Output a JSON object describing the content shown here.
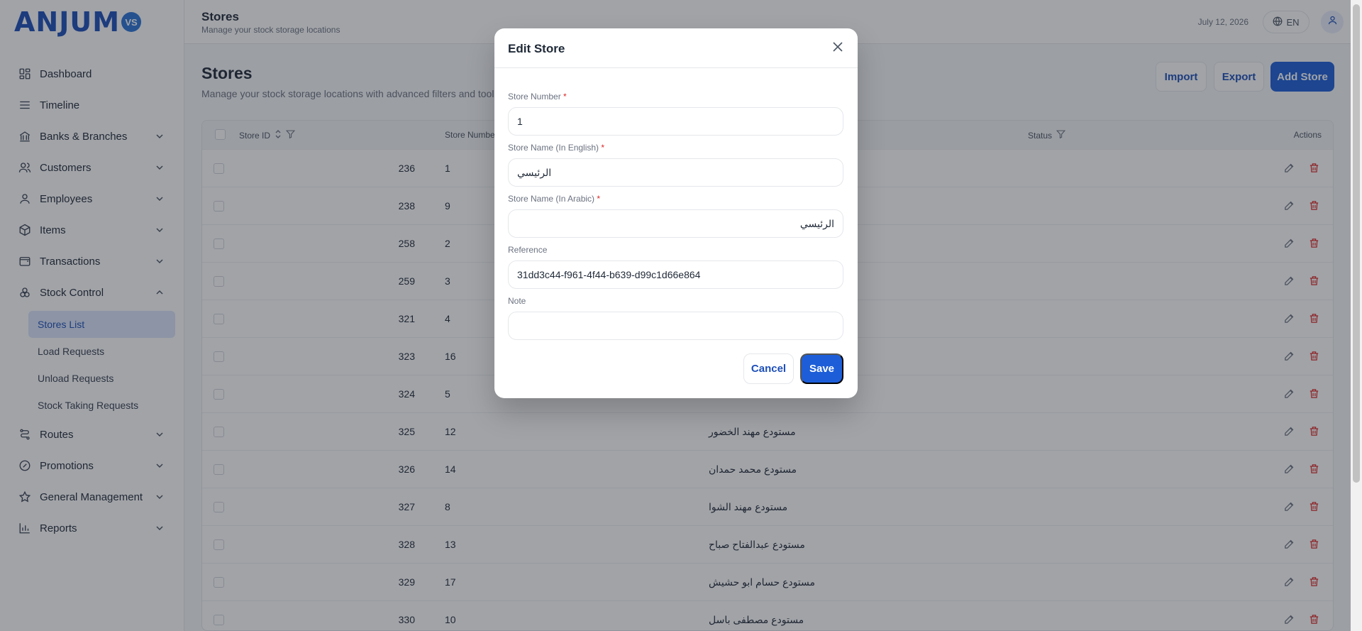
{
  "brand": {
    "logo_text": "ANJUM",
    "logo_badge": "VS"
  },
  "sidebar": {
    "items": [
      {
        "label": "Dashboard",
        "icon": "dashboard-icon",
        "expandable": false
      },
      {
        "label": "Timeline",
        "icon": "list-icon",
        "expandable": false
      },
      {
        "label": "Banks & Branches",
        "icon": "bank-icon",
        "expandable": true
      },
      {
        "label": "Customers",
        "icon": "users-icon",
        "expandable": true
      },
      {
        "label": "Employees",
        "icon": "user-icon",
        "expandable": true
      },
      {
        "label": "Items",
        "icon": "box-icon",
        "expandable": true
      },
      {
        "label": "Transactions",
        "icon": "wallet-icon",
        "expandable": true
      },
      {
        "label": "Stock Control",
        "icon": "stock-icon",
        "expandable": true,
        "expanded": true
      }
    ],
    "stock_sub": [
      "Stores List",
      "Load Requests",
      "Unload Requests",
      "Stock Taking Requests"
    ],
    "items_after": [
      {
        "label": "Routes",
        "icon": "route-icon"
      },
      {
        "label": "Promotions",
        "icon": "promotion-icon"
      },
      {
        "label": "General Management",
        "icon": "star-icon"
      },
      {
        "label": "Reports",
        "icon": "chart-icon"
      }
    ]
  },
  "header": {
    "title": "Stores",
    "subtitle": "Manage your stock storage locations",
    "date": "July 12, 2026",
    "lang": "EN"
  },
  "main": {
    "title": "Stores",
    "description": "Manage your stock storage locations with advanced filters and tools.",
    "import_label": "Import",
    "export_label": "Export",
    "add_label": "Add Store",
    "columns": {
      "id": "Store ID",
      "number": "Store Number",
      "status": "Status",
      "actions": "Actions"
    },
    "rows": [
      {
        "id": "236",
        "number": "1",
        "name": "",
        "active": true
      },
      {
        "id": "238",
        "number": "9",
        "name": "",
        "active": true
      },
      {
        "id": "258",
        "number": "2",
        "name": "",
        "active": true
      },
      {
        "id": "259",
        "number": "3",
        "name": "",
        "active": true
      },
      {
        "id": "321",
        "number": "4",
        "name": "",
        "active": true
      },
      {
        "id": "323",
        "number": "16",
        "name": "",
        "active": true
      },
      {
        "id": "324",
        "number": "5",
        "name": "",
        "active": false
      },
      {
        "id": "325",
        "number": "12",
        "name": "مستودع مهند الخضور",
        "active": true
      },
      {
        "id": "326",
        "number": "14",
        "name": "مستودع محمد حمدان",
        "active": false
      },
      {
        "id": "327",
        "number": "8",
        "name": "مستودع مهند الشوا",
        "active": false
      },
      {
        "id": "328",
        "number": "13",
        "name": "مستودع عبدالفتاح صباح",
        "active": true
      },
      {
        "id": "329",
        "number": "17",
        "name": "مستودع حسام ابو حشيش",
        "active": false
      },
      {
        "id": "330",
        "number": "10",
        "name": "مستودع مصطفى باسل",
        "active": false
      }
    ]
  },
  "modal": {
    "title": "Edit Store",
    "fields": {
      "store_number": {
        "label": "Store Number",
        "value": "1",
        "required": "*"
      },
      "name_en": {
        "label": "Store Name (In English)",
        "value": "الرئيسي",
        "required": "*"
      },
      "name_ar": {
        "label": "Store Name (In Arabic)",
        "value": "الرئيسي",
        "required": "*"
      },
      "reference": {
        "label": "Reference",
        "value": "31dd3c44-f961-4f44-b639-d99c1d66e864"
      },
      "note": {
        "label": "Note",
        "value": ""
      }
    },
    "cancel_label": "Cancel",
    "save_label": "Save"
  },
  "colors": {
    "primary": "#1d5ed8",
    "success": "#1a9b4c",
    "danger": "#dc2626"
  }
}
